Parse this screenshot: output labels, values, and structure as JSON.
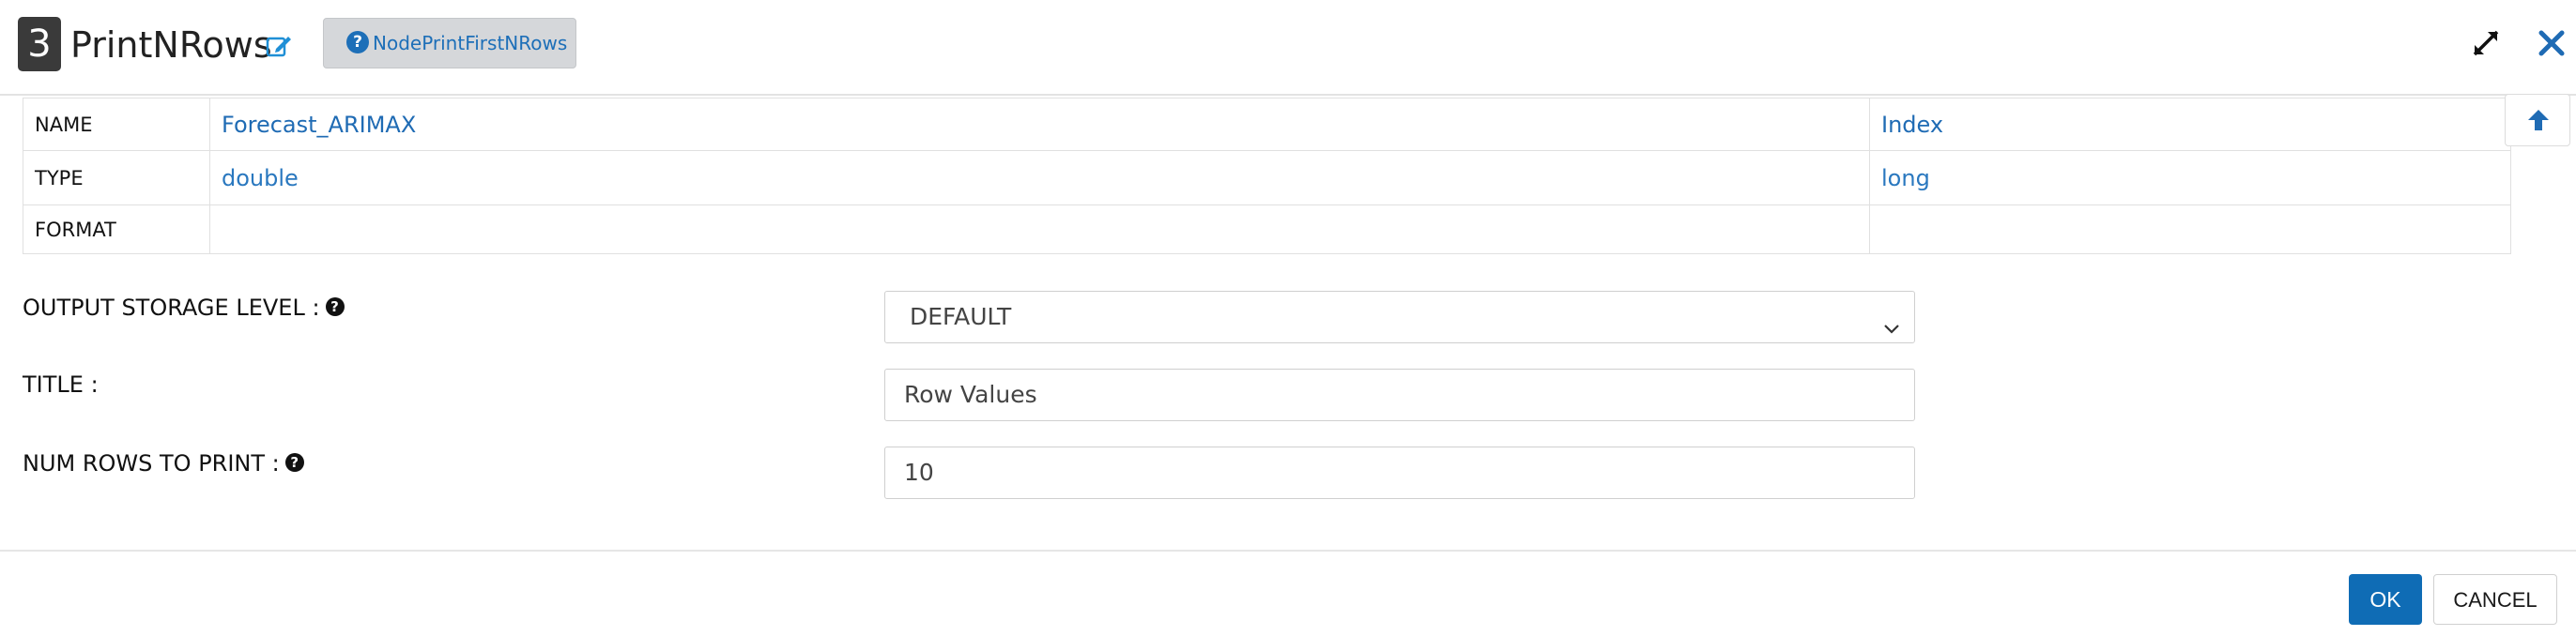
{
  "header": {
    "step_number": "3",
    "node_title": "PrintNRows",
    "help_chip_label": "NodePrintFirstNRows",
    "icons": {
      "edit": "edit-icon",
      "help": "question-circle-icon",
      "expand": "expand-icon",
      "close": "close-icon"
    }
  },
  "schema": {
    "rows": [
      {
        "label": "NAME",
        "values": [
          "Forecast_ARIMAX",
          "Index"
        ]
      },
      {
        "label": "TYPE",
        "values": [
          "double",
          "long"
        ]
      },
      {
        "label": "FORMAT",
        "values": [
          "",
          ""
        ]
      }
    ],
    "scroll_top_icon": "arrow-up-icon"
  },
  "form": {
    "storage_level": {
      "label": "OUTPUT STORAGE LEVEL :",
      "value": "DEFAULT"
    },
    "title": {
      "label": "TITLE :",
      "value": "Row Values"
    },
    "num_rows": {
      "label": "NUM ROWS TO PRINT :",
      "value": "10"
    }
  },
  "footer": {
    "ok_label": "OK",
    "cancel_label": "CANCEL"
  },
  "colors": {
    "accent": "#0f6cb5",
    "link": "#2a78bf",
    "badge_bg": "#3a3a3a",
    "chip_bg": "#d5d7da"
  }
}
